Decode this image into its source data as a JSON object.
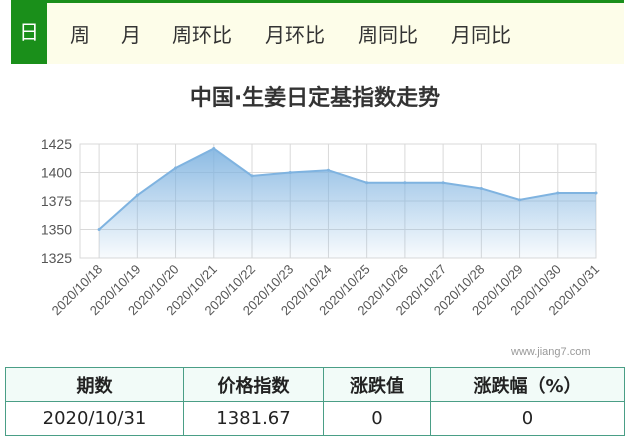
{
  "tabs": [
    {
      "label": "日",
      "active": true
    },
    {
      "label": "周",
      "active": false
    },
    {
      "label": "月",
      "active": false
    },
    {
      "label": "周环比",
      "active": false
    },
    {
      "label": "月环比",
      "active": false
    },
    {
      "label": "周同比",
      "active": false
    },
    {
      "label": "月同比",
      "active": false
    }
  ],
  "colors": {
    "accent": "#1a8f1a",
    "tab_bg": "#fdfde9",
    "line": "#7fb3e0",
    "table_border": "#4a9e86",
    "header_bg": "#f2fbf8"
  },
  "chart_data": {
    "type": "area",
    "title": "中国·生姜日定基指数走势",
    "categories": [
      "2020/10/18",
      "2020/10/19",
      "2020/10/20",
      "2020/10/21",
      "2020/10/22",
      "2020/10/23",
      "2020/10/24",
      "2020/10/25",
      "2020/10/26",
      "2020/10/27",
      "2020/10/28",
      "2020/10/29",
      "2020/10/30",
      "2020/10/31"
    ],
    "series": [
      {
        "values": [
          1350,
          1380,
          1404,
          1421,
          1397,
          1400,
          1402,
          1391,
          1391,
          1391,
          1386,
          1376,
          1382,
          1382
        ]
      }
    ],
    "yticks": [
      1325,
      1350,
      1375,
      1400,
      1425
    ],
    "ylim": [
      1325,
      1425
    ],
    "grid": true
  },
  "watermark": "www.jiang7.com",
  "table": {
    "headers": [
      "期数",
      "价格指数",
      "涨跌值",
      "涨跌幅（%）"
    ],
    "row": [
      "2020/10/31",
      "1381.67",
      "0",
      "0"
    ]
  }
}
